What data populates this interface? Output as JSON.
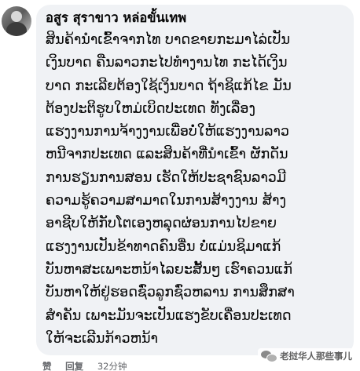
{
  "comment": {
    "author": "อสูร สุราขาว หล่อขั้นเทพ",
    "lines": [
      "ສິນຄ້ານຳເຂົ້າຈາກໄທ ບາດຂາຍກະມາໄລ່ເປັນ",
      "ເງິນບາດ ຄືນລາວກະໄປທຳງານໄທ ກະໄດ້ເງິນ",
      "ບາດ ກະເລີຍຕ້ອງໃຊ້ເງິນບາດ ຖ້າຊິແກ້ໄຂ ມັນ",
      "ຕ້ອງປະຕິຮູບໃຫມ່ເບິດປະເທດ ທັງເລື່ອງ",
      "ແຮງງານການຈ້າງງານເພື່ອບໍ່ໃຫ້ແຮງງານລາວ",
      "ຫນີຈາກປະເທດ ແລະສິນຄ້າທີ່ນຳເຂົ້າ ຜັກດັນ",
      "ການຮຽນການສອນ ເຮັດໃຫ້ປະຊາຊົນລາວມີ",
      "ຄວາມຮູ້ຄວາມສາມາດໃນການສ້າງງານ ສ້າງ",
      "ອາຊີບໃຫ້ກັບໂຕເອງຫລຸດຜ່ອນການໄປຂາຍ",
      "ແຮງງານເປັນຂ້າທາດຄົນອື່ນ ບໍ່ແມ່ນຊິມາແກ້",
      "ບັນຫາສະເພາະຫນ້າໄລຍະສັ້ນໆ ເຮົາຄວນແກ້",
      "ບັນຫາໃຫ້ຢູ່ຮອດຊົ່ວລູກຊົ່ວຫລານ ການສຶກສາ",
      "ສຳຄັນ ເພາະມັນຈະເປັນແຮງຂັບເຄື່ອນປະເທດ",
      "ໃຫ້ຈະເລີນກ້າວຫນ້າ"
    ]
  },
  "actions": {
    "like": "赞",
    "reply": "回复",
    "time": "32分钟"
  },
  "watermark": {
    "text": "老挝华人那些事儿",
    "icon": "wechat-icon"
  },
  "colors": {
    "bubble": "#f0f2f5",
    "text": "#050505",
    "meta": "#65676b"
  }
}
